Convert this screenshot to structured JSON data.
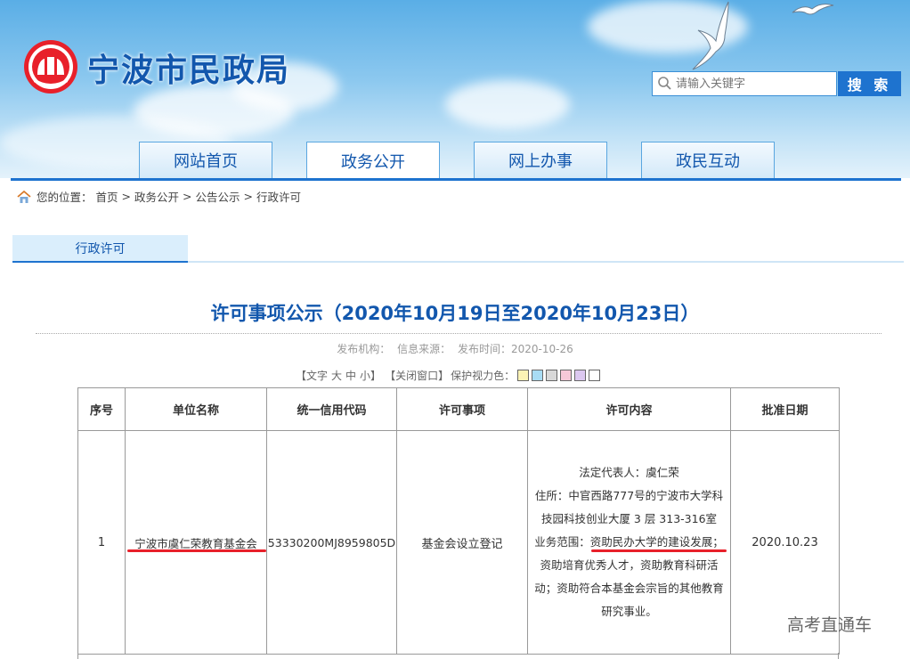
{
  "header": {
    "site_title": "宁波市民政局",
    "search": {
      "placeholder": "请输入关键字",
      "button_label": "搜 索"
    },
    "brand_red": "#e8202a",
    "brand_blue": "#1257ad"
  },
  "nav": {
    "tabs": [
      {
        "label": "网站首页",
        "active": false
      },
      {
        "label": "政务公开",
        "active": true
      },
      {
        "label": "网上办事",
        "active": false
      },
      {
        "label": "政民互动",
        "active": false
      }
    ]
  },
  "breadcrumb": {
    "prefix": "您的位置：",
    "items": [
      "首页",
      "政务公开",
      "公告公示",
      "行政许可"
    ],
    "separator": ">"
  },
  "section": {
    "tab_label": "行政许可"
  },
  "article": {
    "title": "许可事项公示（2020年10月19日至2020年10月23日）",
    "meta": {
      "publisher_label": "发布机构：",
      "source_label": "信息来源：",
      "date_label": "发布时间：",
      "date": "2020-10-26"
    },
    "tools": {
      "font_label_open": "【文字",
      "font_large": "大",
      "font_medium": "中",
      "font_small": "小】",
      "close_window": "【关闭窗口】",
      "eye_care_label": "保护视力色：",
      "swatches": [
        "#fbf3b5",
        "#a8dcf4",
        "#d8d8d8",
        "#f6c8d8",
        "#dcc8f0",
        "#ffffff"
      ]
    }
  },
  "table": {
    "headers": [
      "序号",
      "单位名称",
      "统一信用代码",
      "许可事项",
      "许可内容",
      "批准日期"
    ],
    "rows": [
      {
        "index": "1",
        "org_name": "宁波市虞仁荣教育基金会",
        "credit_code": "53330200MJ8959805D",
        "permit_item": "基金会设立登记",
        "content_lines": [
          "法定代表人：虞仁荣",
          "住所：中官西路777号的宁波市大学科",
          "技园科技创业大厦 3 层 313-316室",
          "业务范围：资助民办大学的建设发展；",
          "资助培育优秀人才，资助教育科研活",
          "动；资助符合本基金会宗旨的其他教育",
          "研究事业。"
        ],
        "approval_date": "2020.10.23"
      }
    ]
  },
  "watermark": "高考直通车"
}
